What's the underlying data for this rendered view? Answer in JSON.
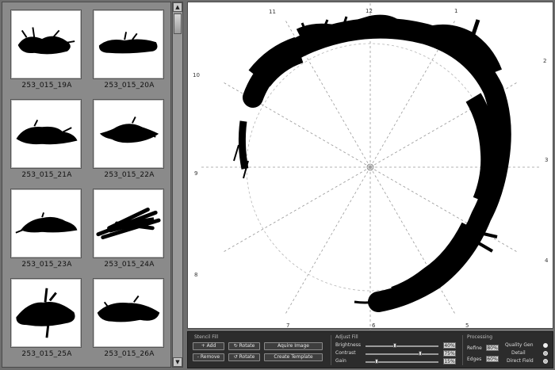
{
  "thumbnails": [
    {
      "label": "253_015_19A"
    },
    {
      "label": "253_015_20A"
    },
    {
      "label": "253_015_21A"
    },
    {
      "label": "253_015_22A"
    },
    {
      "label": "253_015_23A"
    },
    {
      "label": "253_015_24A"
    },
    {
      "label": "253_015_25A"
    },
    {
      "label": "253_015_26A"
    }
  ],
  "canvas": {
    "clock_labels": [
      "12",
      "1",
      "2",
      "3",
      "4",
      "5",
      "6",
      "7",
      "8",
      "9",
      "10",
      "11"
    ]
  },
  "controls": {
    "stencil_title": "Stencil Fill",
    "add_label": "+ Add",
    "remove_label": "- Remove",
    "rotate_cw_label": "↻ Rotate",
    "rotate_ccw_label": "↺ Rotate",
    "acquire_label": "Aquire Image",
    "create_template_label": "Create Template",
    "adjust_title": "Adjust Fill",
    "brightness_label": "Brightness",
    "brightness_value": "40%",
    "brightness_level": 0.4,
    "contrast_label": "Contrast",
    "contrast_value": "75%",
    "contrast_level": 0.75,
    "gain_label": "Gain",
    "gain_value": "15%",
    "gain_level": 0.15,
    "processing_title": "Processing",
    "refine_label": "Refine",
    "refine_value": "80%",
    "edges_label": "Edges",
    "edges_value": "60%",
    "quality_label": "Quality Gen",
    "detail_label": "Detail",
    "direct_field_label": "Direct Field"
  }
}
